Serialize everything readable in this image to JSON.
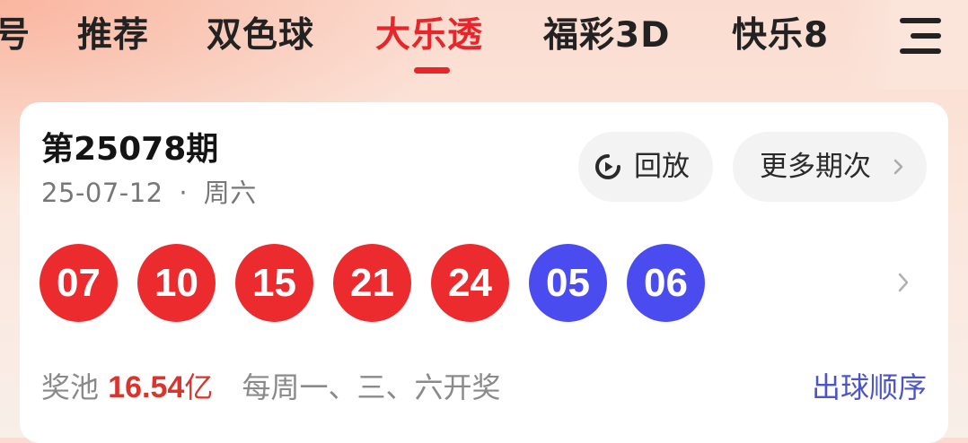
{
  "tabs": [
    {
      "label": "号",
      "active": false
    },
    {
      "label": "推荐",
      "active": false
    },
    {
      "label": "双色球",
      "active": false
    },
    {
      "label": "大乐透",
      "active": true
    },
    {
      "label": "福彩3D",
      "active": false
    },
    {
      "label": "快乐8",
      "active": false
    }
  ],
  "menu_icon": "hamburger-menu-icon",
  "card": {
    "issue_title": "第25078期",
    "date": "25-07-12",
    "separator": "·",
    "weekday": "周六",
    "replay_label": "回放",
    "replay_icon": "replay-play-icon",
    "more_label": "更多期次",
    "more_icon": "chevron-right-icon",
    "red_balls": [
      "07",
      "10",
      "15",
      "21",
      "24"
    ],
    "blue_balls": [
      "05",
      "06"
    ],
    "pool_label": "奖池",
    "pool_amount": "16.54",
    "pool_unit": "亿",
    "schedule": "每周一、三、六开奖",
    "order_link": "出球顺序"
  },
  "colors": {
    "accent_red": "#e6262b",
    "ball_red": "#ec2b2e",
    "ball_blue": "#4a4cf0",
    "link_blue": "#4b54c8"
  }
}
